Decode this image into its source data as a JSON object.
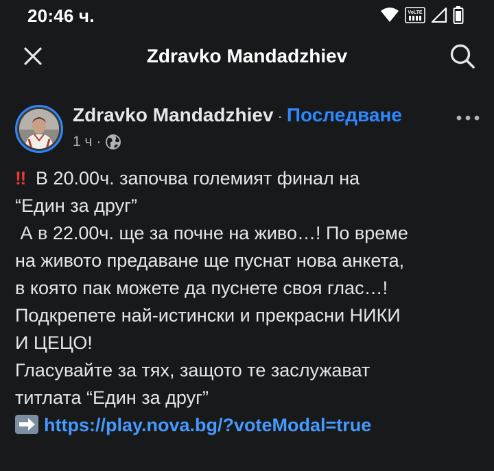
{
  "status_bar": {
    "time": "20:46 ч.",
    "volte_label": "VoLTE"
  },
  "header": {
    "title": "Zdravko Mandadzhiev"
  },
  "post": {
    "author": "Zdravko Mandadzhiev",
    "separator": "·",
    "follow_label": "Последване",
    "time_ago": "1 ч",
    "meta_separator": "·",
    "privacy_icon": "globe-icon",
    "lines": {
      "l1": "В 20.00ч. започва големият финал на",
      "l2": "“Един за друг”",
      "l3": " А в 22.00ч. ще за почне на живо…! По време",
      "l4": "на живото предаване ще пуснат нова анкета,",
      "l5": "в която пак можете да пуснете своя глас…!",
      "l6": "Подкрепете най-истински и прекрасни НИКИ",
      "l7": "И ЦЕЦО!",
      "l8": "Гласувайте за тях, защото те заслужават",
      "l9": "титлата “Един за друг”"
    },
    "link": "https://play.nova.bg/?voteModal=true"
  },
  "colors": {
    "background": "#18191a",
    "accent": "#2d88ff",
    "link": "#4599ff",
    "text": "#e4e6eb",
    "muted": "#b0b3b8"
  }
}
